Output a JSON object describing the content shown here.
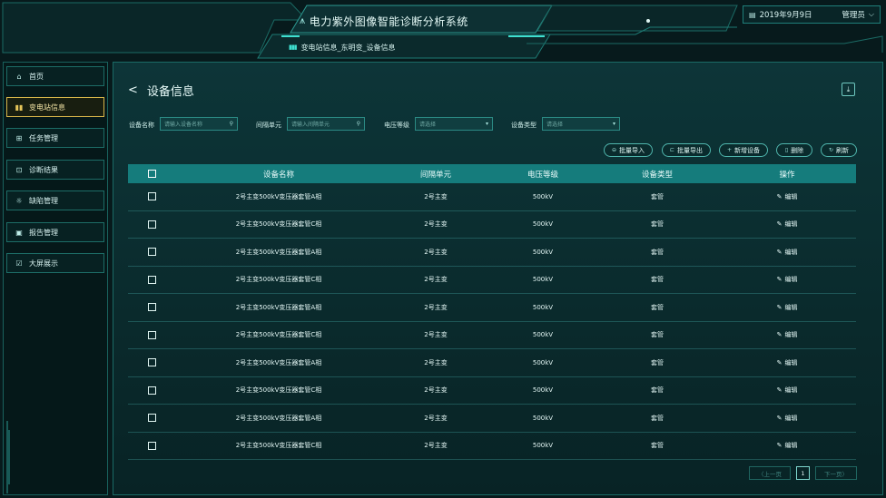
{
  "header": {
    "title": "电力紫外图像智能诊断分析系统",
    "breadcrumb": "变电站信息_东明变_设备信息",
    "date": "2019年9月9日",
    "user": "管理员"
  },
  "sidebar": {
    "items": [
      {
        "label": "首页",
        "icon": "home-icon"
      },
      {
        "label": "变电站信息",
        "icon": "bars-icon",
        "active": true
      },
      {
        "label": "任务管理",
        "icon": "grid-icon"
      },
      {
        "label": "诊断结果",
        "icon": "list-icon"
      },
      {
        "label": "缺陷管理",
        "icon": "bulb-icon"
      },
      {
        "label": "报告管理",
        "icon": "doc-icon"
      },
      {
        "label": "大屏展示",
        "icon": "screen-icon"
      }
    ]
  },
  "page": {
    "title": "设备信息"
  },
  "filters": {
    "device_name_label": "设备名称",
    "device_name_placeholder": "请输入设备名称",
    "bay_label": "间隔单元",
    "bay_placeholder": "请输入间隔单元",
    "voltage_label": "电压等级",
    "voltage_placeholder": "请选择",
    "type_label": "设备类型",
    "type_placeholder": "请选择"
  },
  "toolbar": {
    "import": "批量导入",
    "export": "批量导出",
    "add": "新增设备",
    "delete": "删除",
    "refresh": "刷新"
  },
  "table": {
    "headers": [
      "设备名称",
      "间隔单元",
      "电压等级",
      "设备类型",
      "操作"
    ],
    "rows": [
      {
        "name": "2号主变500kV变压器套管A相",
        "bay": "2号主变",
        "voltage": "500kV",
        "type": "套管",
        "action": "编辑"
      },
      {
        "name": "2号主变500kV变压器套管C相",
        "bay": "2号主变",
        "voltage": "500kV",
        "type": "套管",
        "action": "编辑"
      },
      {
        "name": "2号主变500kV变压器套管A相",
        "bay": "2号主变",
        "voltage": "500kV",
        "type": "套管",
        "action": "编辑"
      },
      {
        "name": "2号主变500kV变压器套管C相",
        "bay": "2号主变",
        "voltage": "500kV",
        "type": "套管",
        "action": "编辑"
      },
      {
        "name": "2号主变500kV变压器套管A相",
        "bay": "2号主变",
        "voltage": "500kV",
        "type": "套管",
        "action": "编辑"
      },
      {
        "name": "2号主变500kV变压器套管C相",
        "bay": "2号主变",
        "voltage": "500kV",
        "type": "套管",
        "action": "编辑"
      },
      {
        "name": "2号主变500kV变压器套管A相",
        "bay": "2号主变",
        "voltage": "500kV",
        "type": "套管",
        "action": "编辑"
      },
      {
        "name": "2号主变500kV变压器套管C相",
        "bay": "2号主变",
        "voltage": "500kV",
        "type": "套管",
        "action": "编辑"
      },
      {
        "name": "2号主变500kV变压器套管A相",
        "bay": "2号主变",
        "voltage": "500kV",
        "type": "套管",
        "action": "编辑"
      },
      {
        "name": "2号主变500kV变压器套管C相",
        "bay": "2号主变",
        "voltage": "500kV",
        "type": "套管",
        "action": "编辑"
      }
    ]
  },
  "pagination": {
    "prev": "上一页",
    "current": "1",
    "next": "下一页"
  },
  "colors": {
    "accent": "#157c7c",
    "active": "#d8b64a",
    "border": "#1a6a65"
  }
}
